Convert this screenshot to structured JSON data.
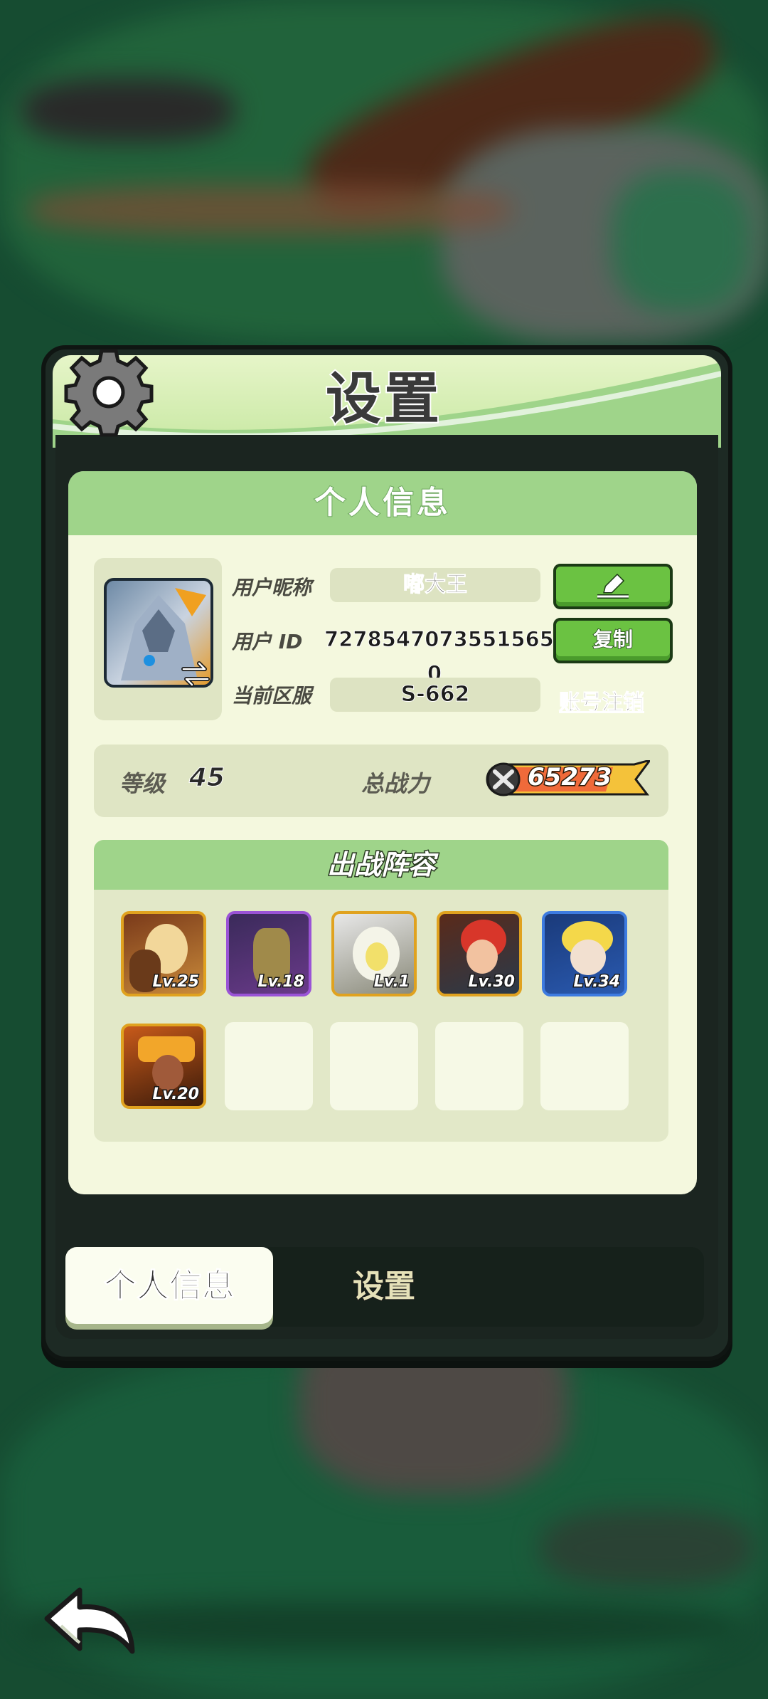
{
  "panel": {
    "title": "设置",
    "section_title": "个人信息"
  },
  "profile": {
    "nickname_label": "用户昵称",
    "nickname": "嘟大王",
    "uid_label": "用户   ID",
    "uid": "7278547073551565 0",
    "server_label": "当前区服",
    "server": "S-662",
    "copy_button": "复制",
    "logout_link": "账号注销",
    "edit_icon": "pencil-icon"
  },
  "stats": {
    "level_label": "等级",
    "level": "45",
    "power_label": "总战力",
    "power": "65273"
  },
  "lineup": {
    "title": "出战阵容",
    "heroes": [
      {
        "level": "Lv.25",
        "frame": "gold"
      },
      {
        "level": "Lv.18",
        "frame": "purple"
      },
      {
        "level": "Lv.1",
        "frame": "gold"
      },
      {
        "level": "Lv.30",
        "frame": "gold"
      },
      {
        "level": "Lv.34",
        "frame": "blue"
      },
      {
        "level": "Lv.20",
        "frame": "gold"
      }
    ]
  },
  "tabs": {
    "profile": "个人信息",
    "settings": "设置"
  },
  "colors": {
    "accent_green": "#6bc242",
    "header_green": "#9fd48a",
    "card_bg": "#f4f8de"
  }
}
